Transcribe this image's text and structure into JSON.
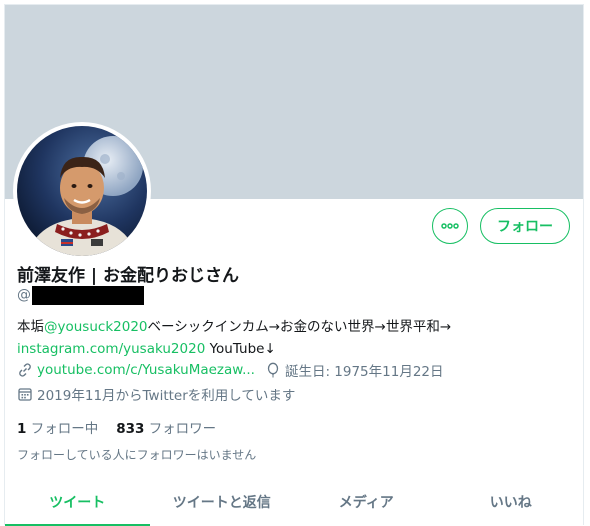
{
  "profile": {
    "name": "前澤友作 | お金配りおじさん",
    "handle_prefix": "@",
    "bio": {
      "prefix": "本垢",
      "mention": "@yousuck2020",
      "text1": "ベーシックインカム→お金のない世界→世界平和→",
      "instagram": "instagram.com/yusaku2020",
      "text2": " YouTube↓"
    },
    "website": "youtube.com/c/YusakuMaezaw...",
    "birthday": "誕生日: 1975年11月22日",
    "joined": "2019年11月からTwitterを利用しています"
  },
  "stats": {
    "following_count": "1",
    "following_label": "フォロー中",
    "followers_count": "833",
    "followers_label": "フォロワー"
  },
  "followed_by_text": "フォローしている人にフォロワーはいません",
  "buttons": {
    "follow_label": "フォロー",
    "more_icon": "more-icon"
  },
  "tabs": [
    {
      "label": "ツイート",
      "active": true
    },
    {
      "label": "ツイートと返信",
      "active": false
    },
    {
      "label": "メディア",
      "active": false
    },
    {
      "label": "いいね",
      "active": false
    }
  ],
  "colors": {
    "accent": "#17bf63",
    "banner": "#ccd6dd",
    "secondary_text": "#657786"
  }
}
